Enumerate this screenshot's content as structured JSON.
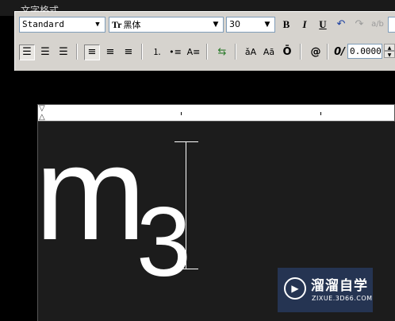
{
  "window": {
    "title": "文字格式"
  },
  "toolbar": {
    "style_value": "Standard",
    "font_value": "黑体",
    "font_prefix": "Tr",
    "height_value": "30",
    "bold_label": "B",
    "italic_label": "I",
    "underline_label": "U",
    "stack_label": "a/b",
    "case_upper_label": "ǎA",
    "case_lower_label": "Aã",
    "overline_label": "Ō",
    "symbol_label": "@",
    "oblique_label": "0/",
    "oblique_value": "0.0000"
  },
  "editor": {
    "text_main": "m",
    "text_sub": "3"
  },
  "watermark": {
    "name": "溜溜自学",
    "url": "ZIXUE.3D66.COM"
  }
}
